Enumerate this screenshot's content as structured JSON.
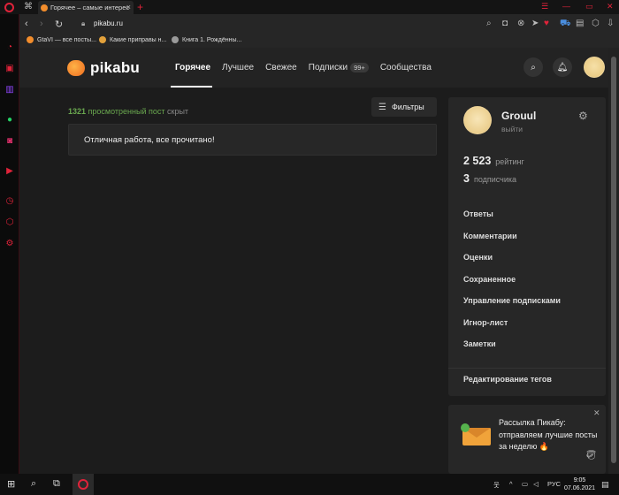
{
  "browser": {
    "tab_title": "Горячее – самые интерес",
    "url": "pikabu.ru",
    "bookmarks": [
      "GtaVI — все посты...",
      "Какие приправы н...",
      "Книга 1. Рождённы..."
    ]
  },
  "site": {
    "logo_text": "pikabu",
    "nav": [
      {
        "label": "Горячее",
        "active": true
      },
      {
        "label": "Лучшее"
      },
      {
        "label": "Свежее"
      },
      {
        "label": "Подписки",
        "badge": "99+"
      },
      {
        "label": "Сообщества"
      }
    ]
  },
  "main": {
    "hidden_count": "1321",
    "hidden_mid": "просмотренный пост",
    "hidden_tail": "скрыт",
    "filters_label": "Фильтры",
    "done_message": "Отличная работа, все прочитано!"
  },
  "profile": {
    "name": "Grouul",
    "subtitle": "выйти",
    "rating_value": "2 523",
    "rating_label": "рейтинг",
    "subs_value": "3",
    "subs_label": "подписчика",
    "menu": [
      "Ответы",
      "Комментарии",
      "Оценки",
      "Сохраненное",
      "Управление подписками",
      "Игнор-лист",
      "Заметки"
    ],
    "edit_tags": "Редактирование тегов"
  },
  "newsletter": {
    "line1": "Рассылка Пикабу:",
    "line2": "отправляем лучшие посты",
    "line3": "за неделю 🔥"
  },
  "taskbar": {
    "lang": "РУС",
    "time": "9:05",
    "date": "07.06.2021"
  },
  "colors": {
    "accent": "#e0233a",
    "hidden_note": "#6aa84f",
    "page_bg": "#1c1c1c"
  }
}
